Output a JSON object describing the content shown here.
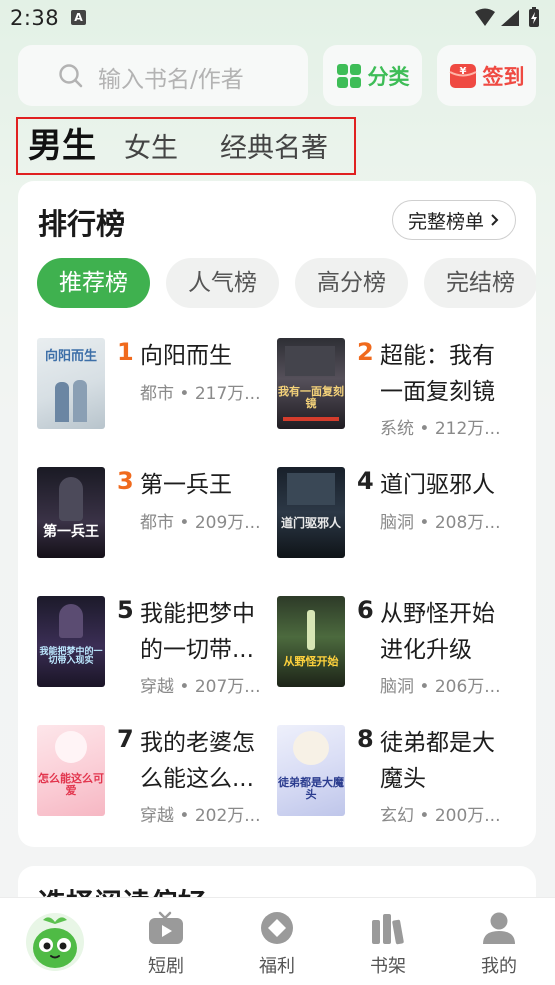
{
  "status_bar": {
    "time": "2:38"
  },
  "search": {
    "placeholder": "输入书名/作者"
  },
  "category_button": {
    "label": "分类"
  },
  "signin_button": {
    "label": "签到"
  },
  "gender_tabs": [
    "男生",
    "女生",
    "经典名著"
  ],
  "ranking": {
    "title": "排行榜",
    "full_list_label": "完整榜单",
    "tabs": [
      "推荐榜",
      "人气榜",
      "高分榜",
      "完结榜"
    ],
    "books": [
      {
        "rank": "1",
        "title": "向阳而生",
        "meta": "都市 • 217万...",
        "cover_text": "向阳而生"
      },
      {
        "rank": "2",
        "title": "超能：我有一面复刻镜",
        "meta": "系统 • 212万...",
        "cover_text": "我有一面复刻镜"
      },
      {
        "rank": "3",
        "title": "第一兵王",
        "meta": "都市 • 209万...",
        "cover_text": "第一兵王"
      },
      {
        "rank": "4",
        "title": "道门驱邪人",
        "meta": "脑洞 • 208万...",
        "cover_text": "道门驱邪人"
      },
      {
        "rank": "5",
        "title": "我能把梦中的一切带...",
        "meta": "穿越 • 207万...",
        "cover_text": "我能把梦中的一切带入现实"
      },
      {
        "rank": "6",
        "title": "从野怪开始进化升级",
        "meta": "脑洞 • 206万...",
        "cover_text": "从野怪开始"
      },
      {
        "rank": "7",
        "title": "我的老婆怎么能这么...",
        "meta": "穿越 • 202万...",
        "cover_text": "怎么能这么可爱"
      },
      {
        "rank": "8",
        "title": "徒弟都是大魔头",
        "meta": "玄幻 • 200万...",
        "cover_text": "徒弟都是大魔头"
      }
    ]
  },
  "next_section": {
    "title": "选择阅读偏好"
  },
  "bottom_nav": [
    {
      "label": "",
      "icon": "mascot-icon"
    },
    {
      "label": "短剧",
      "icon": "tv-icon"
    },
    {
      "label": "福利",
      "icon": "diamond-icon"
    },
    {
      "label": "书架",
      "icon": "bookshelf-icon"
    },
    {
      "label": "我的",
      "icon": "person-icon"
    }
  ],
  "colors": {
    "accent": "#3fb14f",
    "rank_top": "#f06a1d",
    "signin": "#ef4a42",
    "highlight_border": "#e02020"
  }
}
